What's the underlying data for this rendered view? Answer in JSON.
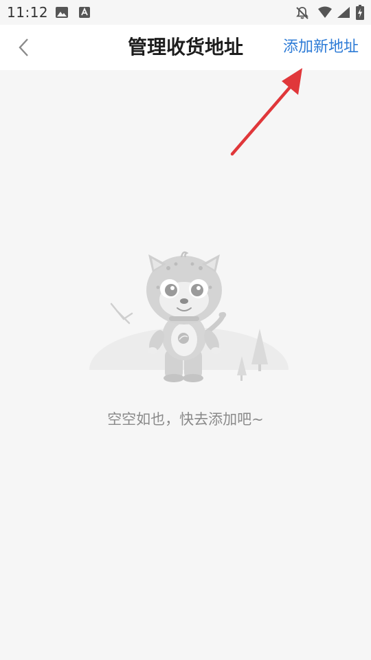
{
  "status_bar": {
    "time": "11:12",
    "left_icons": [
      "image-icon",
      "text-app-icon"
    ],
    "right_icons": [
      "notifications-off-icon",
      "wifi-icon",
      "cell-signal-icon",
      "battery-charging-icon"
    ]
  },
  "header": {
    "back_icon": "chevron-left-icon",
    "title": "管理收货地址",
    "add_label": "添加新地址"
  },
  "annotation": {
    "arrow_color": "#e0373a"
  },
  "empty_state": {
    "illustration": "cartoon-leopard-illustration",
    "message": "空空如也，快去添加吧~"
  },
  "colors": {
    "accent": "#2d7bd6",
    "background": "#f6f6f6",
    "header_background": "#ffffff"
  }
}
